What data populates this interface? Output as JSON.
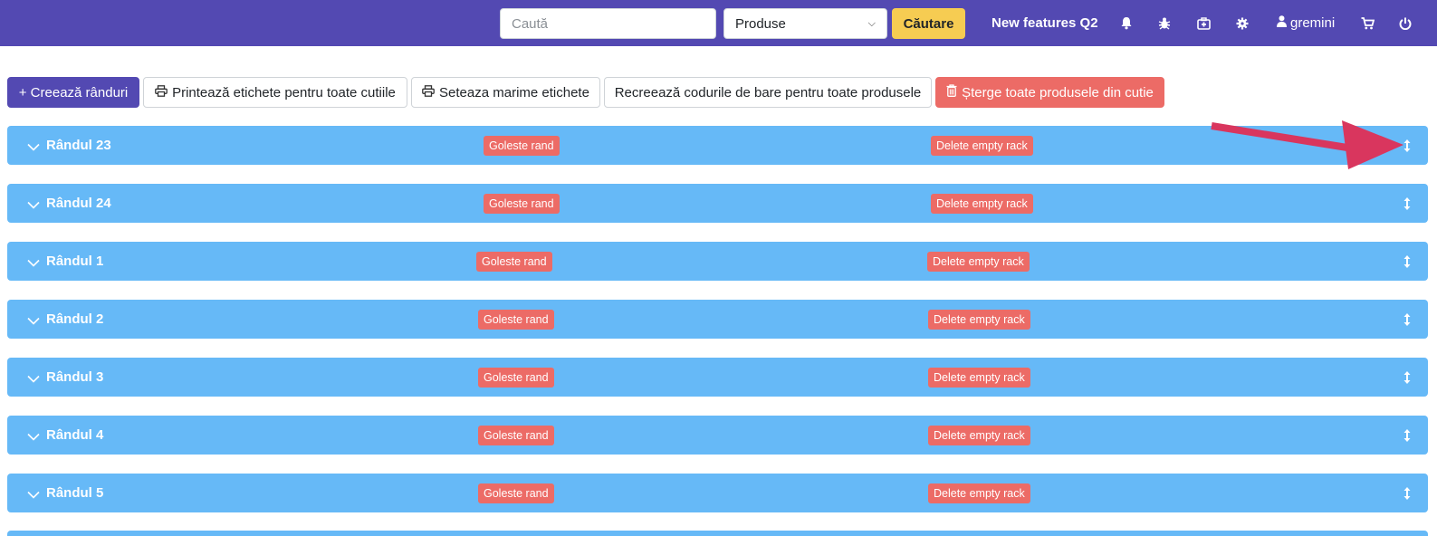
{
  "navbar": {
    "search_placeholder": "Caută",
    "category_selected": "Produse",
    "search_button": "Căutare",
    "new_features_link": "New features Q2",
    "username": "gremini",
    "icons": [
      "bell-icon",
      "bug-icon",
      "medkit-icon",
      "gear-icon",
      "user-icon",
      "cart-icon",
      "power-icon"
    ]
  },
  "toolbar": {
    "create_rows": "+ Creează rânduri",
    "print_labels": "Printează etichete pentru toate cutiile",
    "set_label_size": "Seteaza marime etichete",
    "recreate_barcodes": "Recreează codurile de bare pentru toate produsele",
    "delete_all_products": "Șterge toate produsele din cutie"
  },
  "rows": [
    {
      "title": "Rândul 23",
      "empty_label": "Goleste rand",
      "delete_label": "Delete empty rack"
    },
    {
      "title": "Rândul 24",
      "empty_label": "Goleste rand",
      "delete_label": "Delete empty rack"
    },
    {
      "title": "Rândul 1",
      "empty_label": "Goleste rand",
      "delete_label": "Delete empty rack"
    },
    {
      "title": "Rândul 2",
      "empty_label": "Goleste rand",
      "delete_label": "Delete empty rack"
    },
    {
      "title": "Rândul 3",
      "empty_label": "Goleste rand",
      "delete_label": "Delete empty rack"
    },
    {
      "title": "Rândul 4",
      "empty_label": "Goleste rand",
      "delete_label": "Delete empty rack"
    },
    {
      "title": "Rândul 5",
      "empty_label": "Goleste rand",
      "delete_label": "Delete empty rack"
    }
  ],
  "colors": {
    "navbar": "#5349b2",
    "search_button": "#f6cc52",
    "row": "#66b9f7",
    "danger": "#ec6b66",
    "annotation_arrow": "#d9365e"
  }
}
